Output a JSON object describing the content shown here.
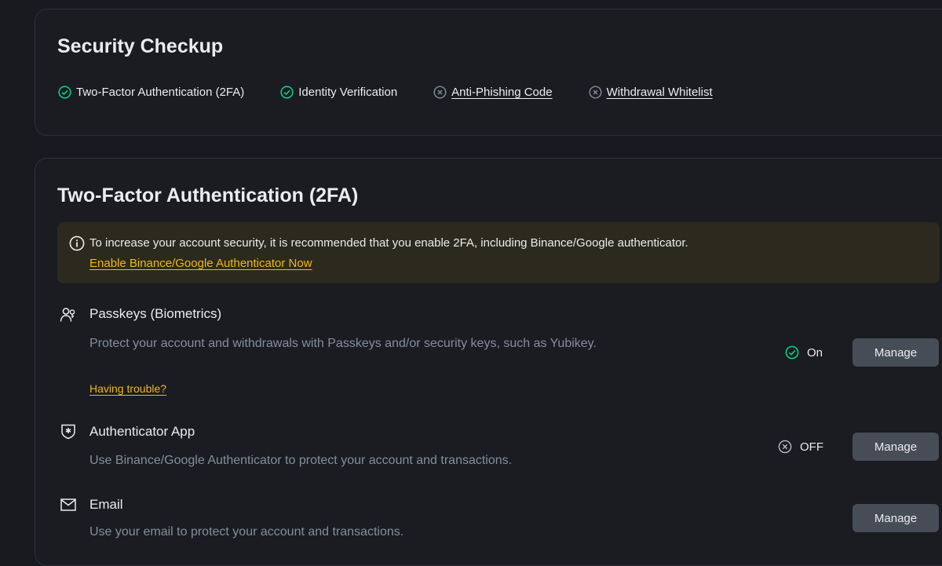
{
  "checkup": {
    "title": "Security Checkup",
    "items": [
      {
        "label": "Two-Factor Authentication (2FA)",
        "done": true
      },
      {
        "label": "Identity Verification",
        "done": true
      },
      {
        "label": "Anti-Phishing Code",
        "done": false
      },
      {
        "label": "Withdrawal Whitelist",
        "done": false
      }
    ]
  },
  "twofa": {
    "title": "Two-Factor Authentication (2FA)",
    "notice": {
      "message": "To increase your account security, it is recommended that you enable 2FA, including Binance/Google authenticator.",
      "link": "Enable Binance/Google Authenticator Now"
    },
    "methods": [
      {
        "icon": "users-icon",
        "title": "Passkeys (Biometrics)",
        "description": "Protect your account and withdrawals with Passkeys and/or security keys, such as Yubikey.",
        "help": "Having trouble?",
        "status": "On",
        "button": "Manage"
      },
      {
        "icon": "shield-asterisk-icon",
        "title": "Authenticator App",
        "description": "Use Binance/Google Authenticator to protect your account and transactions.",
        "status": "OFF",
        "button": "Manage"
      },
      {
        "icon": "mail-icon",
        "title": "Email",
        "description": "Use your email to protect your account and transactions.",
        "button": "Manage"
      }
    ]
  },
  "colors": {
    "background": "#181a20",
    "accent": "#f0b90b",
    "success": "#0ecb81",
    "muted": "#848e9c"
  }
}
